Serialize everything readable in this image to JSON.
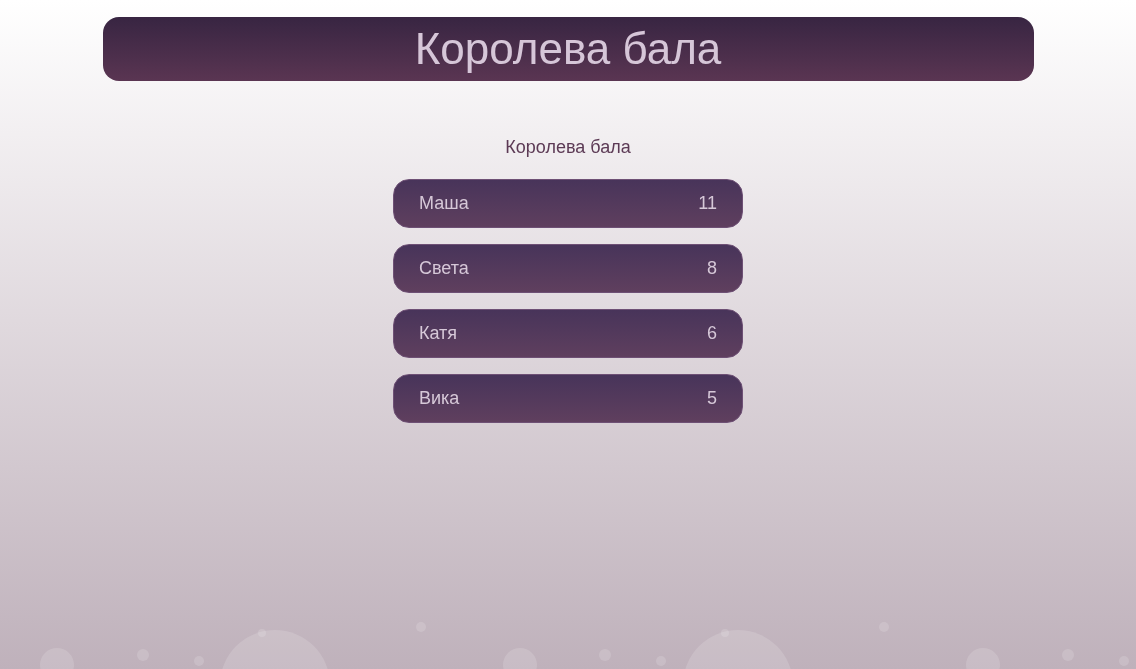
{
  "header": {
    "title": "Королева бала"
  },
  "subtitle": "Королева бала",
  "rows": [
    {
      "name": "Маша",
      "score": "11"
    },
    {
      "name": "Света",
      "score": "8"
    },
    {
      "name": "Катя",
      "score": "6"
    },
    {
      "name": "Вика",
      "score": "5"
    }
  ]
}
